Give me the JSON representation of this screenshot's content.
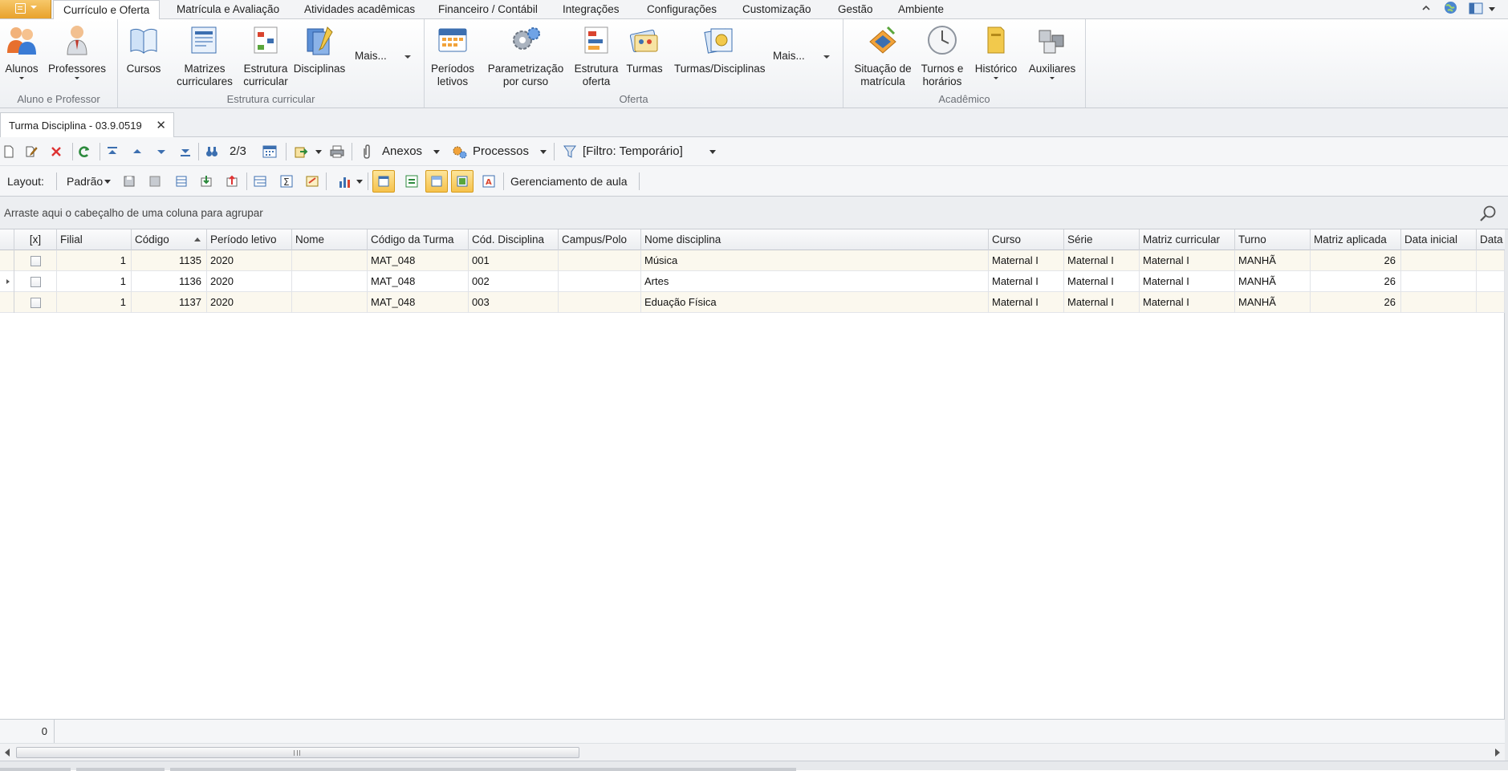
{
  "ribbon_tabs": [
    "Currículo e Oferta",
    "Matrícula e Avaliação",
    "Atividades acadêmicas",
    "Financeiro / Contábil",
    "Integrações",
    "Configurações",
    "Customização",
    "Gestão",
    "Ambiente"
  ],
  "ribbon": {
    "groups": {
      "aluno_professor": {
        "label": "Aluno e Professor",
        "buttons": [
          "Alunos",
          "Professores"
        ]
      },
      "estrutura": {
        "label": "Estrutura curricular",
        "buttons": [
          "Cursos",
          "Matrizes curriculares",
          "Estrutura curricular",
          "Disciplinas"
        ],
        "more": "Mais..."
      },
      "oferta": {
        "label": "Oferta",
        "buttons": [
          "Períodos letivos",
          "Parametrização por curso",
          "Estrutura oferta",
          "Turmas",
          "Turmas/Disciplinas"
        ],
        "more": "Mais..."
      },
      "academico": {
        "label": "Acadêmico",
        "buttons": [
          "Situação de matrícula",
          "Turnos e horários",
          "Histórico",
          "Auxiliares"
        ]
      }
    }
  },
  "doc_tab": {
    "title": "Turma Disciplina - 03.9.0519",
    "close": "✕"
  },
  "toolbar": {
    "record_position": "2/3",
    "anexos": "Anexos",
    "processos": "Processos",
    "filtro": "[Filtro: Temporário]"
  },
  "toolbar2": {
    "layout_label": "Layout:",
    "layout_value": "Padrão",
    "gerenciamento": "Gerenciamento de aula"
  },
  "group_panel_hint": "Arraste aqui o cabeçalho de uma coluna para agrupar",
  "grid": {
    "columns": [
      "[x]",
      "Filial",
      "Código",
      "Período letivo",
      "Nome",
      "Código da Turma",
      "Cód. Disciplina",
      "Campus/Polo",
      "Nome disciplina",
      "Curso",
      "Série",
      "Matriz curricular",
      "Turno",
      "Matriz aplicada",
      "Data inicial",
      "Data"
    ],
    "rows": [
      {
        "filial": "1",
        "codigo": "1135",
        "periodo": "2020",
        "nome": "",
        "turma": "MAT_048",
        "disciplina": "001",
        "campus": "",
        "nome_disciplina": "Música",
        "curso": "Maternal I",
        "serie": "Maternal I",
        "matriz": "Maternal I",
        "turno": "MANHÃ",
        "matriz_aplicada": "26",
        "data_inicial": "",
        "data": ""
      },
      {
        "filial": "1",
        "codigo": "1136",
        "periodo": "2020",
        "nome": "",
        "turma": "MAT_048",
        "disciplina": "002",
        "campus": "",
        "nome_disciplina": "Artes",
        "curso": "Maternal I",
        "serie": "Maternal I",
        "matriz": "Maternal I",
        "turno": "MANHÃ",
        "matriz_aplicada": "26",
        "data_inicial": "",
        "data": ""
      },
      {
        "filial": "1",
        "codigo": "1137",
        "periodo": "2020",
        "nome": "",
        "turma": "MAT_048",
        "disciplina": "003",
        "campus": "",
        "nome_disciplina": "Eduação Física",
        "curso": "Maternal I",
        "serie": "Maternal I",
        "matriz": "Maternal I",
        "turno": "MANHÃ",
        "matriz_aplicada": "26",
        "data_inicial": "",
        "data": ""
      }
    ],
    "footer_count": "0"
  },
  "colors": {
    "accent": "#f6c24b",
    "row_alt": "#fbf8ee"
  }
}
